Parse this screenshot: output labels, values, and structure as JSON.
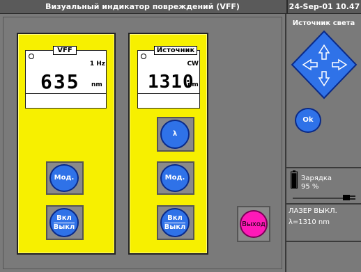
{
  "header": {
    "title": "Визуальный индикатор повреждений (VFF)",
    "datetime": "24-Sep-01 10.47"
  },
  "panel_vff": {
    "tag": "VFF",
    "frequency": "1 Hz",
    "value": "635",
    "unit": "nm",
    "buttons": {
      "mod": "Мод.",
      "onoff_line1": "Вкл",
      "onoff_line2": "Выкл"
    }
  },
  "panel_source": {
    "tag": "Источник",
    "mode": "CW",
    "value": "1310",
    "unit": "nm",
    "buttons": {
      "lambda": "λ",
      "mod": "Мод.",
      "onoff_line1": "Вкл",
      "onoff_line2": "Выкл"
    }
  },
  "exit": {
    "label": "Выход"
  },
  "sidebar": {
    "title": "Источник света",
    "ok": "Ok",
    "battery_label": "Зарядка",
    "battery_percent": "95 %",
    "battery_level": 0.95,
    "laser_status": "ЛАЗЕР ВЫКЛ.",
    "wavelength": "λ=1310 nm"
  },
  "colors": {
    "panel": "#f7f000",
    "button": "#2f72e8",
    "exit": "#ff19b8",
    "background": "#7a7a7a"
  }
}
